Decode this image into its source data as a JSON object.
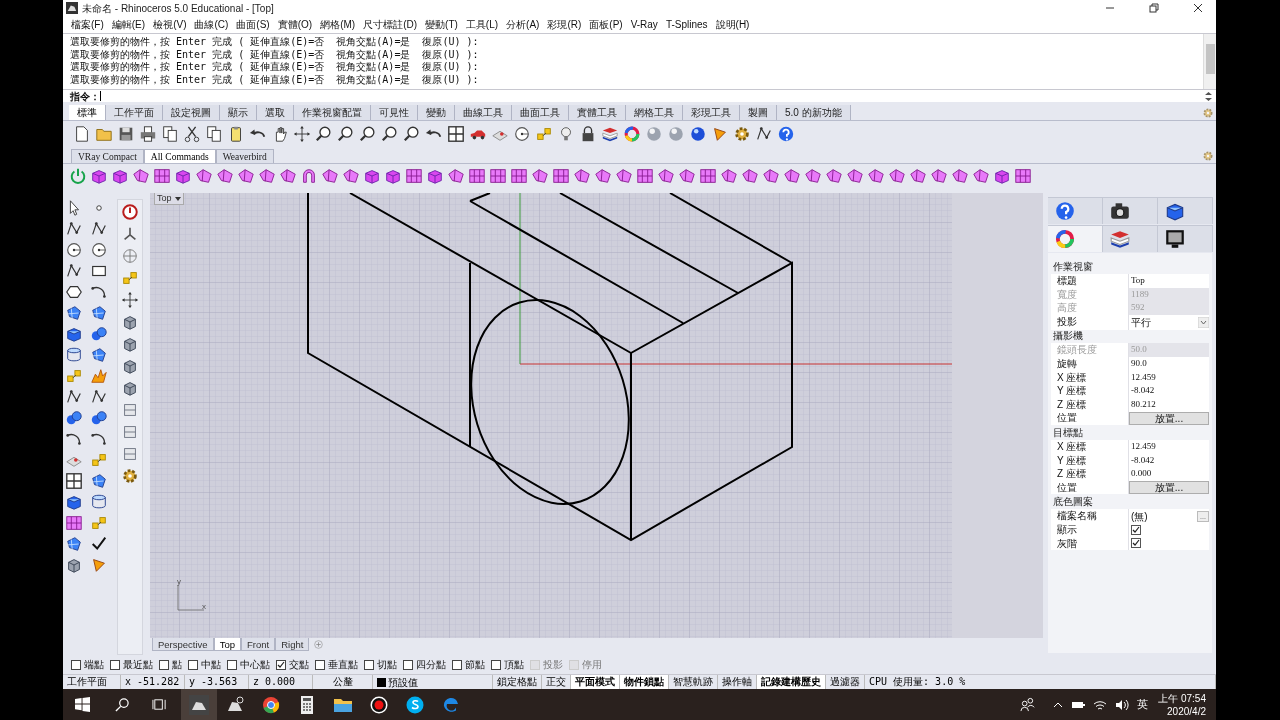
{
  "window": {
    "title": "未命名 - Rhinoceros 5.0 Educational - [Top]"
  },
  "menu": [
    "檔案(F)",
    "編輯(E)",
    "檢視(V)",
    "曲線(C)",
    "曲面(S)",
    "實體(O)",
    "網格(M)",
    "尺寸標註(D)",
    "變動(T)",
    "工具(L)",
    "分析(A)",
    "彩現(R)",
    "面板(P)",
    "V-Ray",
    "T-Splines",
    "說明(H)"
  ],
  "command_history": [
    "選取要修剪的物件，按 Enter 完成 ( 延伸直線(E)=否  視角交點(A)=是  復原(U) ):",
    "選取要修剪的物件，按 Enter 完成 ( 延伸直線(E)=否  視角交點(A)=是  復原(U) ):",
    "選取要修剪的物件，按 Enter 完成 ( 延伸直線(E)=否  視角交點(A)=是  復原(U) ):",
    "選取要修剪的物件，按 Enter 完成 ( 延伸直線(E)=否  視角交點(A)=是  復原(U) ):"
  ],
  "command_prompt": {
    "label": "指令："
  },
  "toolbar_tabs": [
    {
      "label": "標準",
      "selected": true
    },
    {
      "label": "工作平面",
      "selected": false
    },
    {
      "label": "設定視圖",
      "selected": false
    },
    {
      "label": "顯示",
      "selected": false
    },
    {
      "label": "選取",
      "selected": false
    },
    {
      "label": "作業視窗配置",
      "selected": false
    },
    {
      "label": "可見性",
      "selected": false
    },
    {
      "label": "變動",
      "selected": false
    },
    {
      "label": "曲線工具",
      "selected": false
    },
    {
      "label": "曲面工具",
      "selected": false
    },
    {
      "label": "實體工具",
      "selected": false
    },
    {
      "label": "網格工具",
      "selected": false
    },
    {
      "label": "彩現工具",
      "selected": false
    },
    {
      "label": "製圖",
      "selected": false
    },
    {
      "label": "5.0 的新功能",
      "selected": false
    }
  ],
  "panel_tabs": [
    {
      "label": "VRay Compact",
      "selected": false
    },
    {
      "label": "All Commands",
      "selected": true
    },
    {
      "label": "Weaverbird",
      "selected": false
    }
  ],
  "viewport": {
    "title": "Top",
    "axis_labels": [
      "y",
      "x"
    ]
  },
  "viewport_tabs": [
    {
      "label": "Perspective",
      "selected": false
    },
    {
      "label": "Top",
      "selected": true
    },
    {
      "label": "Front",
      "selected": false
    },
    {
      "label": "Right",
      "selected": false
    }
  ],
  "properties": {
    "sections": [
      {
        "title": "作業視窗",
        "rows": [
          {
            "label": "標題",
            "kind": "text",
            "value": "Top",
            "disabled": false
          },
          {
            "label": "寬度",
            "kind": "text",
            "value": "1189",
            "disabled": true
          },
          {
            "label": "高度",
            "kind": "text",
            "value": "592",
            "disabled": true
          },
          {
            "label": "投影",
            "kind": "dropdown",
            "value": "平行",
            "disabled": false
          }
        ]
      },
      {
        "title": "攝影機",
        "rows": [
          {
            "label": "鏡頭長度",
            "kind": "text",
            "value": "50.0",
            "disabled": true
          },
          {
            "label": "旋轉",
            "kind": "text",
            "value": "90.0",
            "disabled": false
          },
          {
            "label": "X 座標",
            "kind": "text",
            "value": "12.459",
            "disabled": false
          },
          {
            "label": "Y 座標",
            "kind": "text",
            "value": "-8.042",
            "disabled": false
          },
          {
            "label": "Z 座標",
            "kind": "text",
            "value": "80.212",
            "disabled": false
          },
          {
            "label": "位置",
            "kind": "button",
            "value": "放置...",
            "disabled": false
          }
        ]
      },
      {
        "title": "目標點",
        "rows": [
          {
            "label": "X 座標",
            "kind": "text",
            "value": "12.459",
            "disabled": false
          },
          {
            "label": "Y 座標",
            "kind": "text",
            "value": "-8.042",
            "disabled": false
          },
          {
            "label": "Z 座標",
            "kind": "text",
            "value": "0.000",
            "disabled": false
          },
          {
            "label": "位置",
            "kind": "button",
            "value": "放置...",
            "disabled": false
          }
        ]
      },
      {
        "title": "底色圖案",
        "rows": [
          {
            "label": "檔案名稱",
            "kind": "file",
            "value": "(無)",
            "browse_label": "...",
            "disabled": false
          },
          {
            "label": "顯示",
            "kind": "checkbox",
            "checked": true,
            "disabled": false
          },
          {
            "label": "灰階",
            "kind": "checkbox",
            "checked": true,
            "disabled": false
          }
        ]
      }
    ]
  },
  "osnaps": [
    {
      "label": "端點",
      "checked": false,
      "disabled": false
    },
    {
      "label": "最近點",
      "checked": false,
      "disabled": false
    },
    {
      "label": "點",
      "checked": false,
      "disabled": false
    },
    {
      "label": "中點",
      "checked": false,
      "disabled": false
    },
    {
      "label": "中心點",
      "checked": false,
      "disabled": false
    },
    {
      "label": "交點",
      "checked": true,
      "disabled": false
    },
    {
      "label": "垂直點",
      "checked": false,
      "disabled": false
    },
    {
      "label": "切點",
      "checked": false,
      "disabled": false
    },
    {
      "label": "四分點",
      "checked": false,
      "disabled": false
    },
    {
      "label": "節點",
      "checked": false,
      "disabled": false
    },
    {
      "label": "頂點",
      "checked": false,
      "disabled": false
    },
    {
      "label": "投影",
      "checked": false,
      "disabled": true
    },
    {
      "label": "停用",
      "checked": false,
      "disabled": true
    }
  ],
  "status_bar": {
    "cplane": "工作平面",
    "x": "x -51.282",
    "y": "y -3.563",
    "z": "z 0.000",
    "units": "公釐",
    "layer": "預設值",
    "toggles": [
      {
        "label": "鎖定格點",
        "on": false
      },
      {
        "label": "正交",
        "on": false
      },
      {
        "label": "平面模式",
        "on": true
      },
      {
        "label": "物件鎖點",
        "on": true
      },
      {
        "label": "智慧軌跡",
        "on": false
      },
      {
        "label": "操作軸",
        "on": false
      },
      {
        "label": "記錄建構歷史",
        "on": true
      },
      {
        "label": "過濾器",
        "on": false
      }
    ],
    "cpu": "CPU 使用量: 3.0 %"
  },
  "taskbar": {
    "language": "英",
    "time": "上午 07:54",
    "date": "2020/4/2"
  }
}
